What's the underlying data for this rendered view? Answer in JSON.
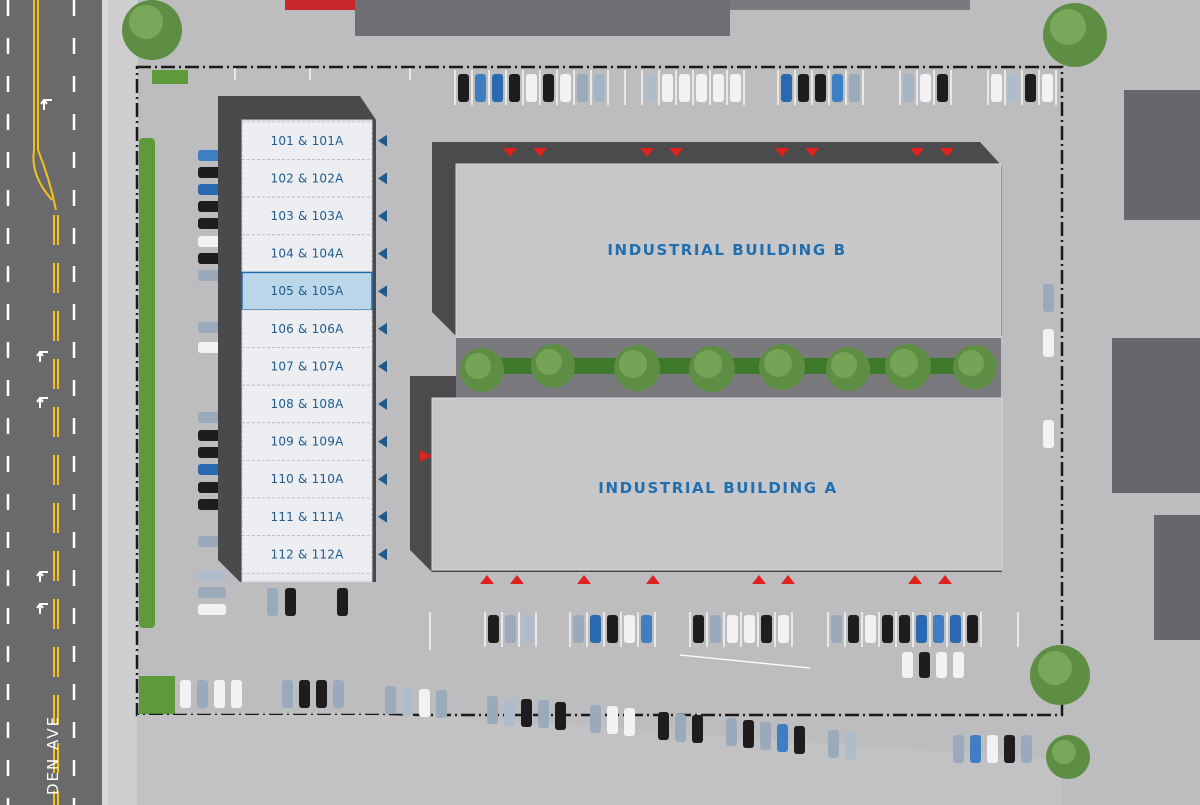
{
  "street_name": "DEN AVE",
  "buildings": {
    "b_label": "INDUSTRIAL BUILDING B",
    "a_label": "INDUSTRIAL BUILDING A"
  },
  "units": [
    {
      "label": "101 & 101A",
      "highlighted": false
    },
    {
      "label": "102 & 102A",
      "highlighted": false
    },
    {
      "label": "103 & 103A",
      "highlighted": false
    },
    {
      "label": "104 & 104A",
      "highlighted": false
    },
    {
      "label": "105 & 105A",
      "highlighted": true
    },
    {
      "label": "106 & 106A",
      "highlighted": false
    },
    {
      "label": "107 & 107A",
      "highlighted": false
    },
    {
      "label": "108 & 108A",
      "highlighted": false
    },
    {
      "label": "109 & 109A",
      "highlighted": false
    },
    {
      "label": "110 & 110A",
      "highlighted": false
    },
    {
      "label": "111 & 111A",
      "highlighted": false
    },
    {
      "label": "112 & 112A",
      "highlighted": false
    }
  ],
  "colors": {
    "ground": "#b9b9bb",
    "building_roof": "#c6c6c9",
    "unit_highlight": "#bcd6ea",
    "label_blue": "#1f6fb0",
    "door_marker_red": "#e0221e",
    "door_marker_blue": "#1f5b8c",
    "road": "#6b6b6d",
    "road_line_yellow": "#f2c21b"
  }
}
